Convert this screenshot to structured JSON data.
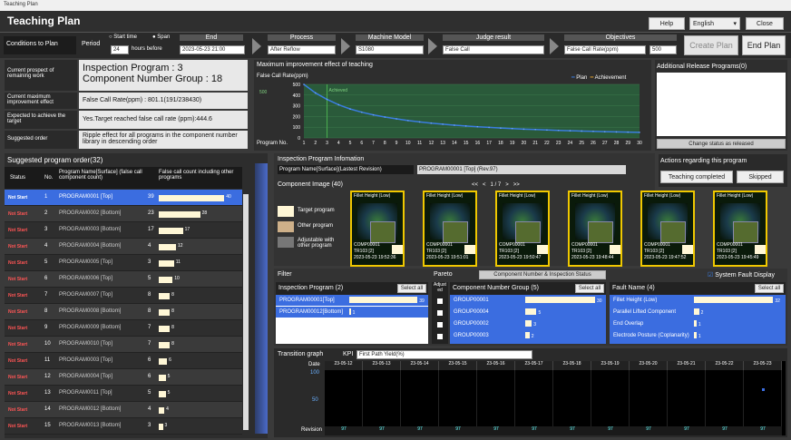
{
  "window_title": "Teaching Plan",
  "page_title": "Teaching Plan",
  "header": {
    "help": "Help",
    "language": "English",
    "close": "Close"
  },
  "conditions": {
    "label": "Conditions to Plan",
    "period_label": "Period",
    "opt1": "Start time",
    "opt2": "Span",
    "end_label": "End",
    "hours": "24",
    "hours_before": "hours before",
    "end_value": "2023-05-23 21:00",
    "process_label": "Process",
    "process_value": "After Reflow",
    "machine_label": "Machine Model",
    "machine_value": "S1080",
    "judge_label": "Judge result",
    "judge_value": "False Call",
    "objectives_label": "Objectives",
    "objectives_value": "False Call Rate(ppm)",
    "objectives_num": "500",
    "create_plan": "Create Plan",
    "end_plan": "End Plan"
  },
  "prospect": {
    "remaining_label": "Current prospect of remaining work",
    "remaining_l1": "Inspection Program : 3",
    "remaining_l2": "Component Number Group : 18",
    "max_label": "Current maximum improvement effect",
    "max_value": "False Call Rate(ppm) : 801.1(191/238430)",
    "expect_label": "Expected to achieve the target",
    "expect_value": "Yes.Target reached false call rate (ppm):444.6",
    "order_label": "Suggested order",
    "order_value": "Ripple effect for all programs in the component number library in descending order"
  },
  "chart_title": "Maximum improvement effect of teaching",
  "chart_data": {
    "type": "line",
    "ylabel": "False Call Rate(ppm)",
    "xlabel": "Program No.",
    "ylim": [
      0,
      500
    ],
    "yticks": [
      "500",
      "400",
      "300",
      "200",
      "100",
      "0"
    ],
    "x": [
      1,
      2,
      3,
      4,
      5,
      6,
      7,
      8,
      9,
      10,
      11,
      12,
      13,
      14,
      15,
      16,
      17,
      18,
      19,
      20,
      21,
      22,
      23,
      24,
      25,
      26,
      27,
      28,
      29,
      30
    ],
    "series": [
      {
        "name": "Plan",
        "values": [
          500,
          420,
          360,
          310,
          270,
          240,
          215,
          195,
          178,
          162,
          149,
          138,
          128,
          119,
          111,
          104,
          98,
          92,
          87,
          82,
          78,
          74,
          70,
          67,
          64,
          61,
          58,
          56,
          54,
          52
        ]
      }
    ],
    "legend": [
      "Plan",
      "Achievement"
    ],
    "target_label": "500",
    "achieved_label": "Achieved",
    "achieved_x": 3
  },
  "release": {
    "title": "Additional Release Programs(0)",
    "btn": "Change status as released"
  },
  "suggested": {
    "title": "Suggested program order(32)",
    "h_status": "Status",
    "h_no": "No.",
    "h_prog": "Program Name[Surface] (false call component count)",
    "h_fc": "False call count including other programs"
  },
  "rows": [
    {
      "status": "Not Start",
      "no": "1",
      "prog": "PROGRAM0001 [Top]",
      "cnt": "39",
      "fc": "40",
      "w": 0.95
    },
    {
      "status": "Not Start",
      "no": "2",
      "prog": "PROGRAM0002 [Bottom]",
      "cnt": "23",
      "fc": "28",
      "w": 0.6
    },
    {
      "status": "Not Start",
      "no": "3",
      "prog": "PROGRAM0003 [Bottom]",
      "cnt": "17",
      "fc": "17",
      "w": 0.35
    },
    {
      "status": "Not Start",
      "no": "4",
      "prog": "PROGRAM0004 [Bottom]",
      "cnt": "4",
      "fc": "12",
      "w": 0.25
    },
    {
      "status": "Not Start",
      "no": "5",
      "prog": "PROGRAM0005 [Top]",
      "cnt": "3",
      "fc": "11",
      "w": 0.22
    },
    {
      "status": "Not Start",
      "no": "6",
      "prog": "PROGRAM0006 [Top]",
      "cnt": "5",
      "fc": "10",
      "w": 0.2
    },
    {
      "status": "Not Start",
      "no": "7",
      "prog": "PROGRAM0007 [Top]",
      "cnt": "8",
      "fc": "8",
      "w": 0.16
    },
    {
      "status": "Not Start",
      "no": "8",
      "prog": "PROGRAM0008 [Bottom]",
      "cnt": "8",
      "fc": "8",
      "w": 0.16
    },
    {
      "status": "Not Start",
      "no": "9",
      "prog": "PROGRAM0009 [Bottom]",
      "cnt": "7",
      "fc": "8",
      "w": 0.16
    },
    {
      "status": "Not Start",
      "no": "10",
      "prog": "PROGRAM0010 [Top]",
      "cnt": "7",
      "fc": "8",
      "w": 0.16
    },
    {
      "status": "Not Start",
      "no": "11",
      "prog": "PROGRAM0003 [Top]",
      "cnt": "6",
      "fc": "6",
      "w": 0.12
    },
    {
      "status": "Not Start",
      "no": "12",
      "prog": "PROGRAM0004 [Top]",
      "cnt": "6",
      "fc": "5",
      "w": 0.1
    },
    {
      "status": "Not Start",
      "no": "13",
      "prog": "PROGRAM0011 [Top]",
      "cnt": "5",
      "fc": "5",
      "w": 0.1
    },
    {
      "status": "Not Start",
      "no": "14",
      "prog": "PROGRAM0012 [Bottom]",
      "cnt": "4",
      "fc": "4",
      "w": 0.08
    },
    {
      "status": "Not Start",
      "no": "15",
      "prog": "PROGRAM0013 [Bottom]",
      "cnt": "3",
      "fc": "3",
      "w": 0.06
    }
  ],
  "info": {
    "title": "Inspection Program Infomation",
    "prog_label": "Program Name[Surface](Lastest Revision)",
    "prog_value": "PROGRAM00001 [Top] (Rev.97)",
    "comp_title": "Component Image (40)",
    "nav": "<<   <   1 / 7   >   >>",
    "legend": [
      "Target program",
      "Other program",
      "Adjustable with other program"
    ]
  },
  "actions": {
    "title": "Actions regarding this program",
    "completed": "Teaching completed",
    "skipped": "Skipped"
  },
  "thumbs": [
    {
      "label": "Fillet Height (Low)",
      "c1": "COMP00001",
      "c2": "TR103 [2]",
      "c3": "2023-05-23 19:52:36"
    },
    {
      "label": "Fillet Height (Low)",
      "c1": "COMP00001",
      "c2": "TR103 [2]",
      "c3": "2023-05-23 19:51:01"
    },
    {
      "label": "Fillet Height (Low)",
      "c1": "COMP00001",
      "c2": "TR103 [2]",
      "c3": "2023-05-23 19:50:47"
    },
    {
      "label": "Fillet Height (Low)",
      "c1": "COMP00001",
      "c2": "TR103 [2]",
      "c3": "2023-05-23 19:48:44"
    },
    {
      "label": "Fillet Height (Low)",
      "c1": "COMP00001",
      "c2": "TR103 [2]",
      "c3": "2023-05-23 19:47:52"
    },
    {
      "label": "Fillet Height (Low)",
      "c1": "COMP00001",
      "c2": "TR103 [2]",
      "c3": "2023-05-23 19:45:49"
    }
  ],
  "filter": {
    "title": "Filter",
    "pareto": "Pareto",
    "pareto_btn": "Component Number & Inspection Status",
    "sys_fault": "System Fault Display",
    "ip_title": "Inspection Program (2)",
    "select_all": "Select all",
    "adjusted": "Adjust ed",
    "ip_items": [
      {
        "n": "PROGRAM00001[Top]",
        "v": "39"
      },
      {
        "n": "PROGRAM00012[Bottom]",
        "v": "1"
      }
    ],
    "cng_title": "Component Number Group (5)",
    "cng_items": [
      {
        "n": "GROUP00001",
        "v": "30"
      },
      {
        "n": "GROUP00004",
        "v": "5"
      },
      {
        "n": "GROUP00002",
        "v": "3"
      },
      {
        "n": "GROUP00003",
        "v": "2"
      }
    ],
    "fault_title": "Fault Name (4)",
    "fault_items": [
      {
        "n": "Fillet Height (Low)",
        "v": "32"
      },
      {
        "n": "Parallel Lifted Component",
        "v": "2"
      },
      {
        "n": "End Overlap",
        "v": "1"
      },
      {
        "n": "Electrode Posture (Coplanarity)",
        "v": "1"
      }
    ]
  },
  "transition": {
    "title": "Transition graph",
    "kpi": "KPI",
    "kpi_value": "First Path Yield(%)",
    "date": "Date",
    "revision": "Revision",
    "dates": [
      "23-05-12",
      "23-05-13",
      "23-05-14",
      "23-05-15",
      "23-05-16",
      "23-05-17",
      "23-05-18",
      "23-05-19",
      "23-05-20",
      "23-05-21",
      "23-05-22",
      "23-05-23"
    ],
    "rev": "97",
    "y100": "100",
    "y50": "50"
  }
}
